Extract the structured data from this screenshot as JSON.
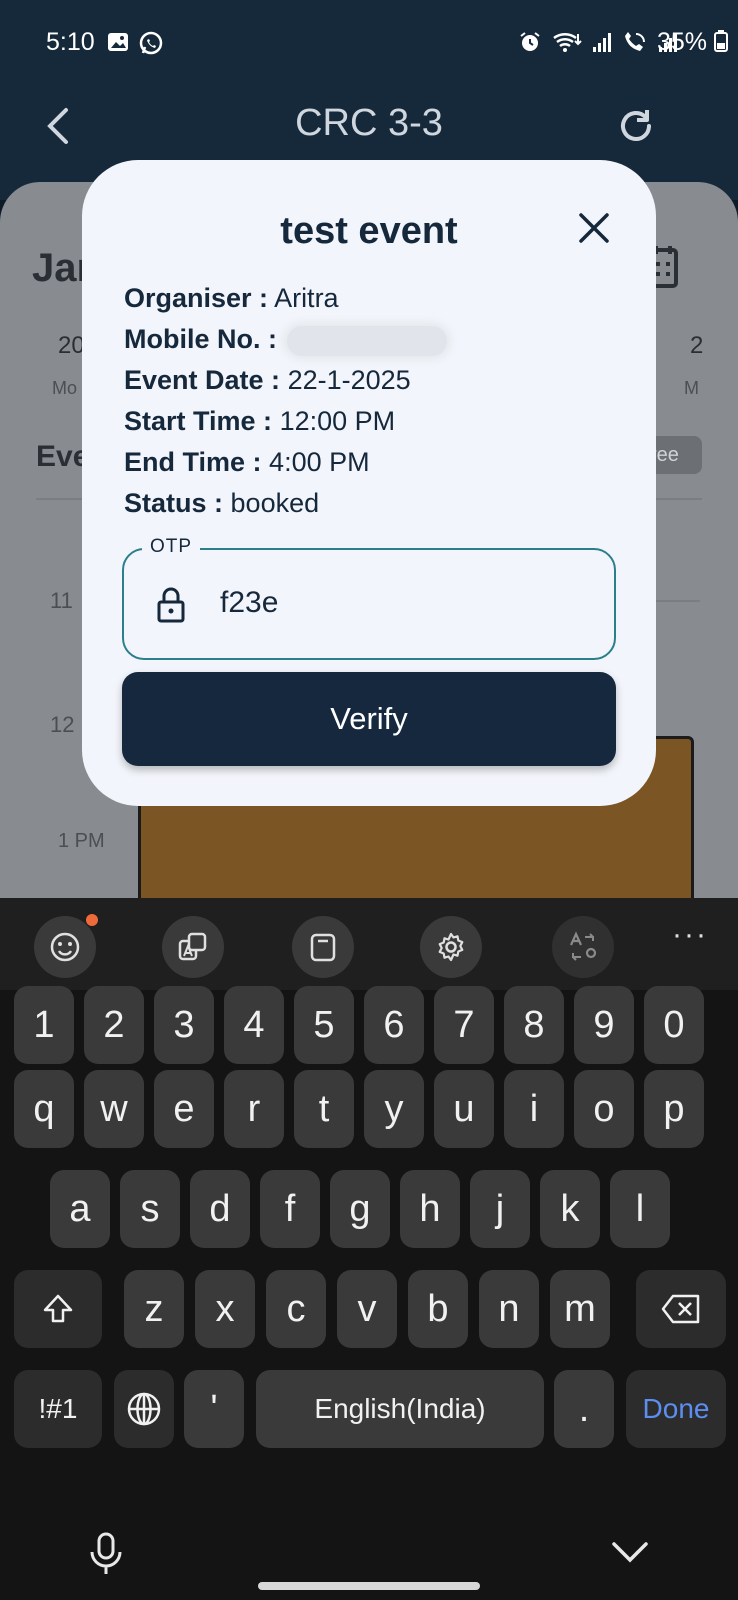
{
  "status_bar": {
    "time": "5:10",
    "battery": "35%",
    "icons": [
      "gallery-icon",
      "whatsapp-icon",
      "alarm-icon",
      "wifi-icon",
      "signal-icon",
      "wifi-call-icon",
      "signal-icon",
      "battery-icon"
    ]
  },
  "header": {
    "title": "CRC 3-3",
    "back_icon": "chevron-left-icon",
    "refresh_icon": "refresh-icon"
  },
  "background": {
    "month_partial": "Jan",
    "date_left": "20",
    "day_left": "Mo",
    "date_right": "2",
    "day_right": "M",
    "events_partial": "Eve",
    "chip_partial": "ree",
    "time_11": "11",
    "time_12": "12",
    "time_1pm": "1 PM"
  },
  "dialog": {
    "title": "test event",
    "rows": [
      {
        "label": "Organiser :",
        "value": "Aritra"
      },
      {
        "label": "Mobile No. :",
        "value": ""
      },
      {
        "label": "Event Date :",
        "value": "22-1-2025"
      },
      {
        "label": "Start Time :",
        "value": "12:00 PM"
      },
      {
        "label": "End Time :",
        "value": "4:00 PM"
      },
      {
        "label": "Status :",
        "value": "booked"
      }
    ],
    "otp": {
      "label": "OTP",
      "value": "f23e"
    },
    "verify_label": "Verify"
  },
  "keyboard": {
    "toolbar_more": "···",
    "row1": [
      "1",
      "2",
      "3",
      "4",
      "5",
      "6",
      "7",
      "8",
      "9",
      "0"
    ],
    "row2": [
      "q",
      "w",
      "e",
      "r",
      "t",
      "y",
      "u",
      "i",
      "o",
      "p"
    ],
    "row3": [
      "a",
      "s",
      "d",
      "f",
      "g",
      "h",
      "j",
      "k",
      "l"
    ],
    "row4": [
      "z",
      "x",
      "c",
      "v",
      "b",
      "n",
      "m"
    ],
    "symbols": "!#1",
    "apostrophe": "'",
    "space": "English(India)",
    "period": ".",
    "done": "Done"
  }
}
